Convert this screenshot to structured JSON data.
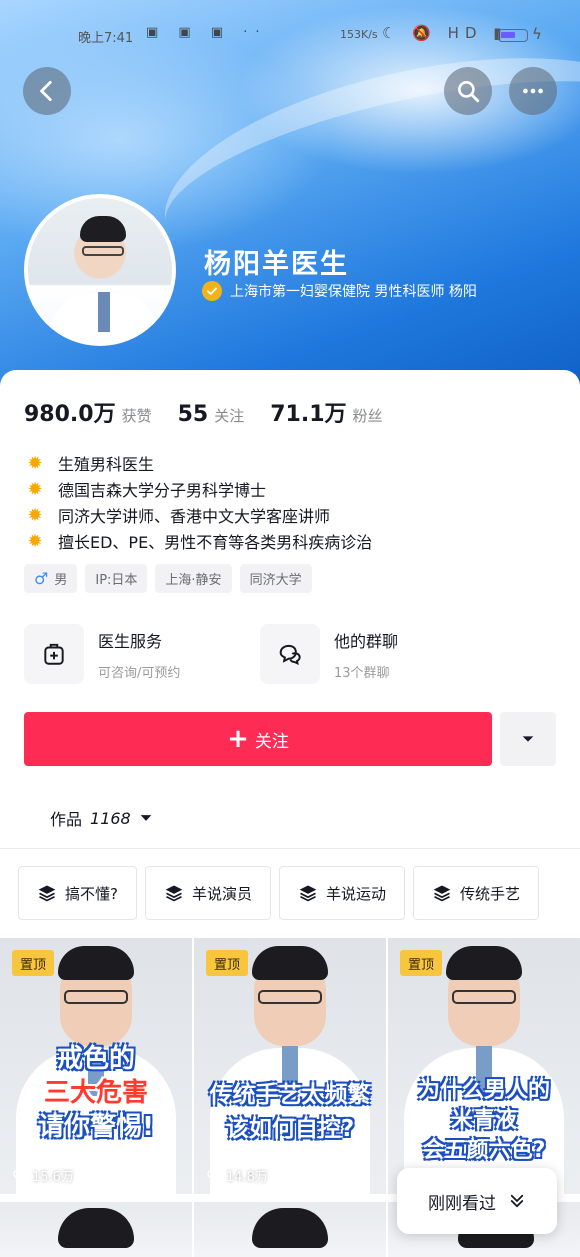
{
  "status_bar": {
    "time": "晚上7:41",
    "speed": "153K/s",
    "left_icons": "▣ ▣ ▣ ··",
    "right_icons": "☾ 🔕 HD ▮"
  },
  "header": {
    "back_icon": "chevron-left-icon",
    "search_icon": "search-icon",
    "more_icon": "ellipsis-icon"
  },
  "profile": {
    "name": "杨阳羊医生",
    "verified_text": "上海市第一妇婴保健院 男性科医师 杨阳",
    "stats": [
      {
        "value": "980.0万",
        "label": "获赞"
      },
      {
        "value": "55",
        "label": "关注"
      },
      {
        "value": "71.1万",
        "label": "粉丝"
      }
    ],
    "bio": [
      "生殖男科医生",
      "德国吉森大学分子男科学博士",
      "同济大学讲师、香港中文大学客座讲师",
      "擅长ED、PE、男性不育等各类男科疾病诊治"
    ],
    "tags": [
      "男",
      "IP:日本",
      "上海·静安",
      "同济大学"
    ]
  },
  "services": [
    {
      "title": "医生服务",
      "subtitle": "可咨询/可预约",
      "icon": "medical-kit-icon"
    },
    {
      "title": "他的群聊",
      "subtitle": "13个群聊",
      "icon": "chat-bubbles-icon"
    }
  ],
  "actions": {
    "follow_label": "关注",
    "more_icon": "caret-down-icon"
  },
  "works": {
    "label": "作品",
    "count": "1168"
  },
  "collections": [
    "搞不懂?",
    "羊说演员",
    "羊说运动",
    "传统手艺"
  ],
  "videos": [
    {
      "pinned": "置顶",
      "caption": [
        "戒色的",
        "三大危害",
        "请你警惕!"
      ],
      "likes": "15.6万"
    },
    {
      "pinned": "置顶",
      "caption": [
        "传统手艺太频繁",
        "该如何自控?"
      ],
      "likes": "14.8万"
    },
    {
      "pinned": "置顶",
      "caption": [
        "为什么男人的",
        "米青液",
        "会五颜六色?"
      ],
      "likes": ""
    }
  ],
  "recent_popup": {
    "label": "刚刚看过"
  },
  "colors": {
    "accent": "#fe2c55",
    "verified": "#f2b21a",
    "pinned": "#f8c63e"
  }
}
